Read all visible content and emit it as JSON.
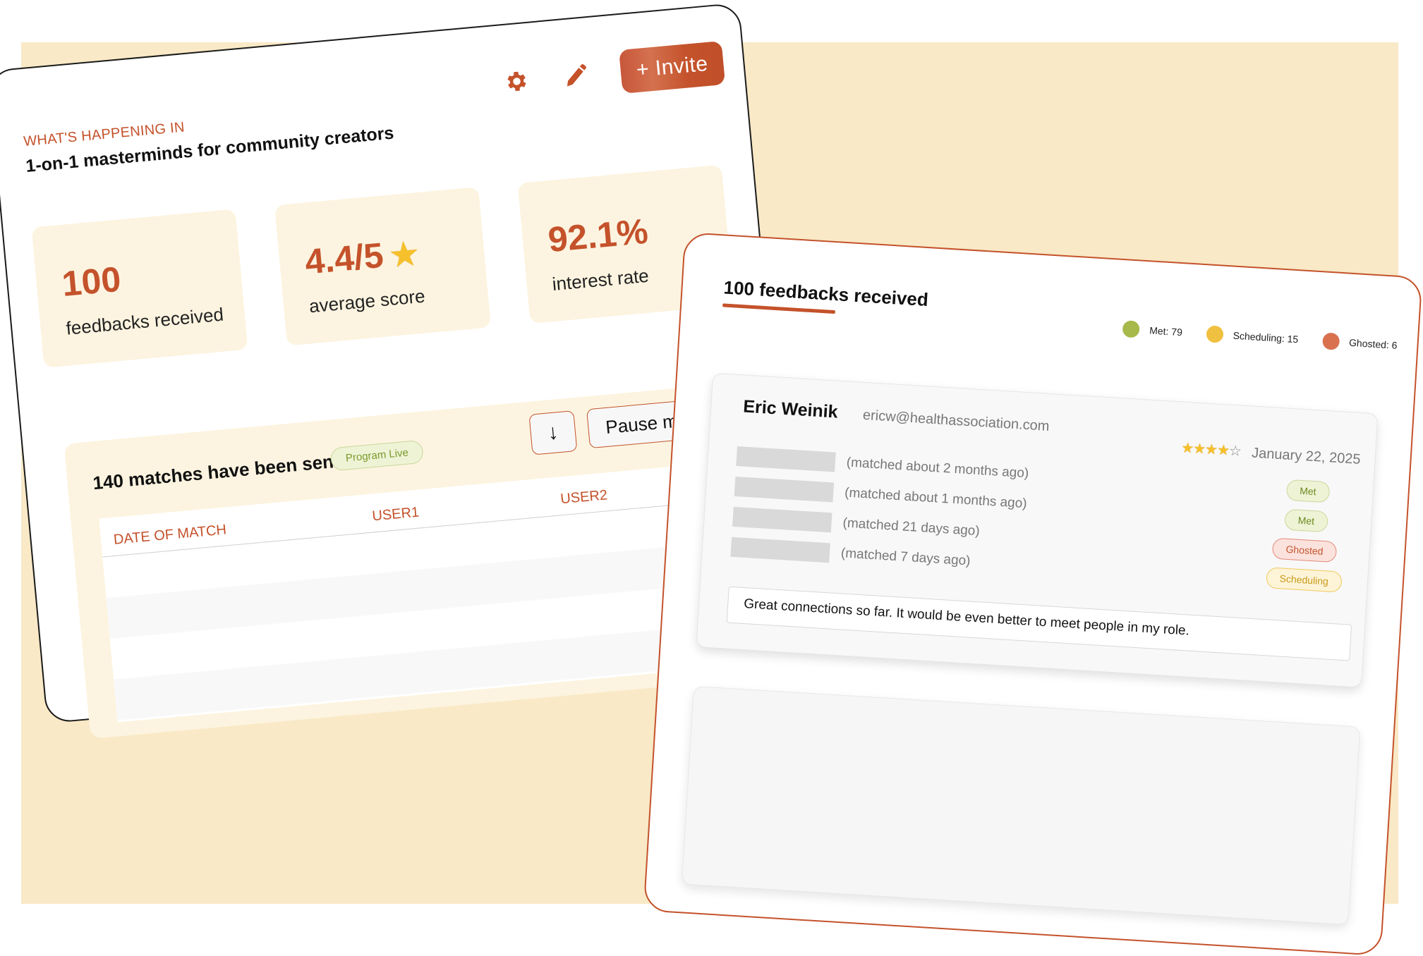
{
  "colors": {
    "accent": "#c4522b",
    "backdrop": "#f9e9c6",
    "stat_card": "#fcf4e0",
    "met": "#a6b94a",
    "scheduling": "#f0c040",
    "ghosted": "#d9714f"
  },
  "dashboard": {
    "eyebrow": "WHAT'S HAPPENING IN",
    "program_title": "1-on-1 masterminds for community creators",
    "actions": {
      "settings_icon": "gear-icon",
      "edit_icon": "pencil-icon",
      "invite_label": "+ Invite"
    },
    "stats": [
      {
        "value": "100",
        "label": "feedbacks received"
      },
      {
        "value": "4.4/5",
        "label": "average score",
        "icon": "★"
      },
      {
        "value": "92.1%",
        "label": "interest rate"
      }
    ],
    "matches": {
      "title": "140 matches have been sent",
      "status_badge": "Program Live",
      "download_icon": "↓",
      "pause_label": "Pause m",
      "columns": [
        "DATE OF MATCH",
        "USER1",
        "USER2"
      ],
      "rows": [
        [],
        [],
        [],
        []
      ]
    }
  },
  "feedback": {
    "title": "100 feedbacks received",
    "legend": [
      {
        "label": "Met: 79",
        "color": "#a6b94a"
      },
      {
        "label": "Scheduling: 15",
        "color": "#f0c040"
      },
      {
        "label": "Ghosted: 6",
        "color": "#d9714f"
      }
    ],
    "entry": {
      "name": "Eric Weinik",
      "email": "ericw@healthassociation.com",
      "rating": 4,
      "rating_max": 5,
      "stars_on": "★★★★",
      "stars_off": "☆",
      "date": "January 22, 2025",
      "matches": [
        {
          "text": "(matched about 2 months ago)",
          "status": "Met"
        },
        {
          "text": "(matched about 1 months ago)",
          "status": "Met"
        },
        {
          "text": "(matched 21 days ago)",
          "status": "Ghosted"
        },
        {
          "text": "(matched 7 days ago)",
          "status": "Scheduling"
        }
      ],
      "comment": "Great connections so far. It would be even better to meet people in my role."
    }
  }
}
